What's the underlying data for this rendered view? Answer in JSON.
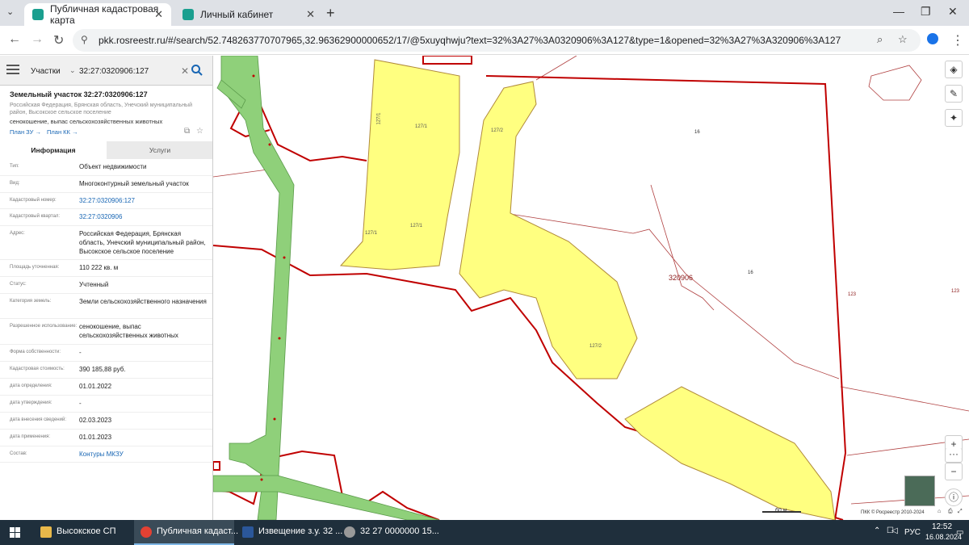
{
  "browser": {
    "tabs": [
      {
        "label": "Публичная кадастровая карта",
        "active": true
      },
      {
        "label": "Личный кабинет",
        "active": false
      }
    ],
    "url": "pkk.rosreestr.ru/#/search/52.748263770707965,32.96362900000652/17/@5xuyqhwju?text=32%3A27%3A0320906%3A127&type=1&opened=32%3A27%3A320906%3A127"
  },
  "search": {
    "category": "Участки",
    "value": "32:27:0320906:127"
  },
  "parcel": {
    "title": "Земельный участок 32:27:0320906:127",
    "address": "Российская Федерация, Брянская область, Унечский муниципальный район, Высокское сельское поселение",
    "use": "сенокошение, выпас сельскохозяйственных животных",
    "plan_zu": "План ЗУ →",
    "plan_kk": "План КК →"
  },
  "info_tabs": {
    "info": "Информация",
    "services": "Услуги"
  },
  "fields": [
    {
      "label": "Тип:",
      "value": "Объект недвижимости",
      "link": false
    },
    {
      "label": "Вид:",
      "value": "Многоконтурный земельный участок",
      "link": false
    },
    {
      "label": "Кадастровый номер:",
      "value": "32:27:0320906:127",
      "link": true
    },
    {
      "label": "Кадастровый квартал:",
      "value": "32:27:0320906",
      "link": true
    },
    {
      "label": "Адрес:",
      "value": "Российская Федерация, Брянская область, Унечский муниципальный район, Высокское сельское поселение",
      "link": false
    },
    {
      "label": "Площадь уточненная:",
      "value": "110 222 кв. м",
      "link": false
    },
    {
      "label": "Статус:",
      "value": "Учтенный",
      "link": false
    },
    {
      "label": "Категория земель:",
      "value": "Земли сельскохозяйственного назначения",
      "link": false
    },
    {
      "label": "Разрешенное использование:",
      "value": "сенокошение, выпас сельскохозяйственных животных",
      "link": false
    },
    {
      "label": "Форма собственности:",
      "value": "-",
      "link": false
    },
    {
      "label": "Кадастровая стоимость:",
      "value": "390 185,88 руб.",
      "link": false
    },
    {
      "label": "дата определения:",
      "value": "01.01.2022",
      "link": false
    },
    {
      "label": "дата утверждения:",
      "value": "-",
      "link": false
    },
    {
      "label": "дата внесения сведений:",
      "value": "02.03.2023",
      "link": false
    },
    {
      "label": "дата применения:",
      "value": "01.01.2023",
      "link": false
    },
    {
      "label": "Состав:",
      "value": "Контуры МКЗУ",
      "link": true
    }
  ],
  "map": {
    "labels": {
      "q1": "127/1",
      "q2": "127/1",
      "q3": "127/1",
      "q4": "127/1",
      "q5": "127/2",
      "q6": "127/2",
      "n16a": "16",
      "n16b": "16",
      "quarter": "320906",
      "n123a": "123",
      "n123b": "123"
    },
    "scale": "60 м",
    "copyright": "ПКК © Росреестр 2010-2024"
  },
  "taskbar": {
    "items": [
      "Высокское СП",
      "Публичная кадаст...",
      "Извещение з.у. 32 ...",
      "32  27  0000000  15..."
    ],
    "lang": "РУС",
    "time": "12:52",
    "date": "16.08.2024"
  },
  "colors": {
    "parcel_fill": "#ffff80",
    "road_fill": "#8fd07a",
    "boundary": "#c00000",
    "accent": "#1866b4"
  }
}
